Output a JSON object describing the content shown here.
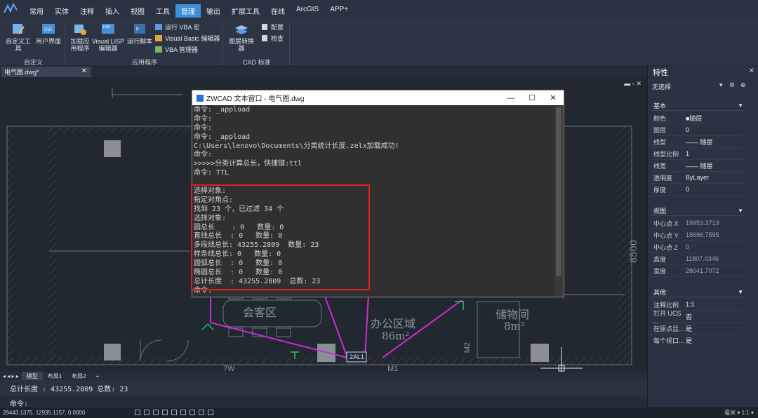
{
  "menubar": {
    "items": [
      "常用",
      "实体",
      "注释",
      "插入",
      "视图",
      "工具",
      "管理",
      "输出",
      "扩展工具",
      "在线",
      "ArcGIS",
      "APP+"
    ],
    "active": "管理"
  },
  "ribbon": {
    "custom_tool": "自定义工具",
    "user_interface": "用户界面",
    "load_app": "加载应\n用程序",
    "visual_lisp": "Visual LISP\n编辑器",
    "run_script": "运行脚本",
    "run_vba": "运行 VBA 宏",
    "vb_editor": "Visual Basic 编辑器",
    "vba_manager": "VBA 管理器",
    "layer_converter": "图层转换器",
    "config": "配置",
    "check": "检查",
    "group_custom": "自定义",
    "group_apps": "应用程序",
    "group_cad": "CAD 标准"
  },
  "document": {
    "tab_name": "电气图.dwg*"
  },
  "text_window": {
    "title": "ZWCAD 文本窗口 - 电气图.dwg",
    "lines": [
      "命令: _appload",
      "命令:",
      "命令:",
      "命令: _appload",
      "C:\\Users\\lenovo\\Documents\\分类统计长度.zelx加载成功!",
      "命令:",
      ">>>>>分类计算总长，快捷键:ttl",
      "命令: TTL",
      "",
      "选择对象:",
      "指定对角点:",
      "找到 23 个，已过滤 34 个",
      "选择对象:",
      "圆总长    : 0   数量: 0",
      "直线总长  : 0   数量: 0",
      "多段线总长: 43255.2809  数量: 23",
      "样条线总长: 0   数量: 0",
      "圆弧总长  : 0   数量: 0",
      "椭圆总长  : 0   数量: 0",
      "总计长度  : 43255.2809  总数: 23",
      "命令:"
    ]
  },
  "drawing": {
    "room1": "会客区",
    "room2": "办公区域",
    "room2_area": "86m²",
    "room3": "储物间",
    "room3_area": "8m²",
    "label_box": "2AL1",
    "dim_right": "8500",
    "m1": "M1",
    "m2": "M2",
    "w7": "7W"
  },
  "properties": {
    "title": "特性",
    "selection": "无选择",
    "sections": {
      "basic": "基本",
      "view": "视图",
      "other": "其他"
    },
    "basic": [
      {
        "k": "颜色",
        "v": "■随层"
      },
      {
        "k": "图层",
        "v": "0"
      },
      {
        "k": "线型",
        "v": "—— 随层"
      },
      {
        "k": "线型比例",
        "v": "1"
      },
      {
        "k": "线宽",
        "v": "—— 随层"
      },
      {
        "k": "透明度",
        "v": "ByLayer"
      },
      {
        "k": "厚度",
        "v": "0"
      }
    ],
    "view": [
      {
        "k": "中心点 X",
        "v": "19953.3713"
      },
      {
        "k": "中心点 Y",
        "v": "18696.7595"
      },
      {
        "k": "中心点 Z",
        "v": "0"
      },
      {
        "k": "高度",
        "v": "11807.0346"
      },
      {
        "k": "宽度",
        "v": "28041.7072"
      }
    ],
    "other": [
      {
        "k": "注释比例",
        "v": "1:1"
      },
      {
        "k": "打开 UCS ...",
        "v": "否"
      },
      {
        "k": "在原点显...",
        "v": "是"
      },
      {
        "k": "每个视口...",
        "v": "是"
      }
    ]
  },
  "layout_tabs": [
    "模型",
    "布局1",
    "布局2",
    "+"
  ],
  "command": {
    "history": "总计长度  : 43255.2809  总数: 23",
    "prompt": "命令:"
  },
  "status": {
    "coords": "29443.1375, 12935.1157, 0.0000",
    "right": "毫米 ▾  1:1 ▾"
  }
}
